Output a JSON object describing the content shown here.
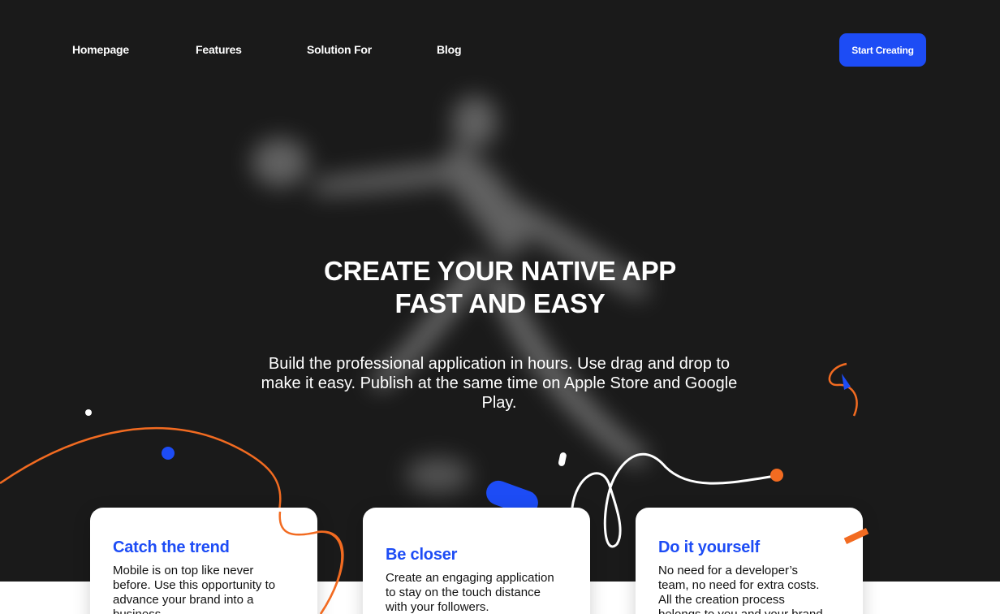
{
  "nav": {
    "links": [
      "Homepage",
      "Features",
      "Solution For",
      "Blog"
    ],
    "cta_label": "Start Creating"
  },
  "hero": {
    "headline_line1": "CREATE YOUR NATIVE APP",
    "headline_line2": "FAST AND EASY",
    "subtext_line1": "Build the professional application in hours. Use drag and drop to",
    "subtext_line2": "make it easy. Publish at the same time on Apple Store and Google",
    "subtext_line3": "Play."
  },
  "cards": [
    {
      "title": "Catch the trend",
      "body": [
        "Mobile is on top like never",
        "before. Use this opportunity to",
        "advance your brand into a",
        "business."
      ]
    },
    {
      "title": "Be closer",
      "body": [
        "Create an engaging application",
        "to stay on the touch distance",
        "with your followers."
      ]
    },
    {
      "title": "Do it yourself",
      "body": [
        "No need for a developer’s",
        "team, no need for extra costs.",
        "All the creation process",
        "belongs to you and your brand."
      ]
    }
  ],
  "colors": {
    "accent_blue": "#1d4cf5",
    "accent_orange": "#f26b21",
    "hero_bg": "#1a1a1a"
  },
  "icons": {
    "hero_image": "blurred-runner-photo"
  }
}
